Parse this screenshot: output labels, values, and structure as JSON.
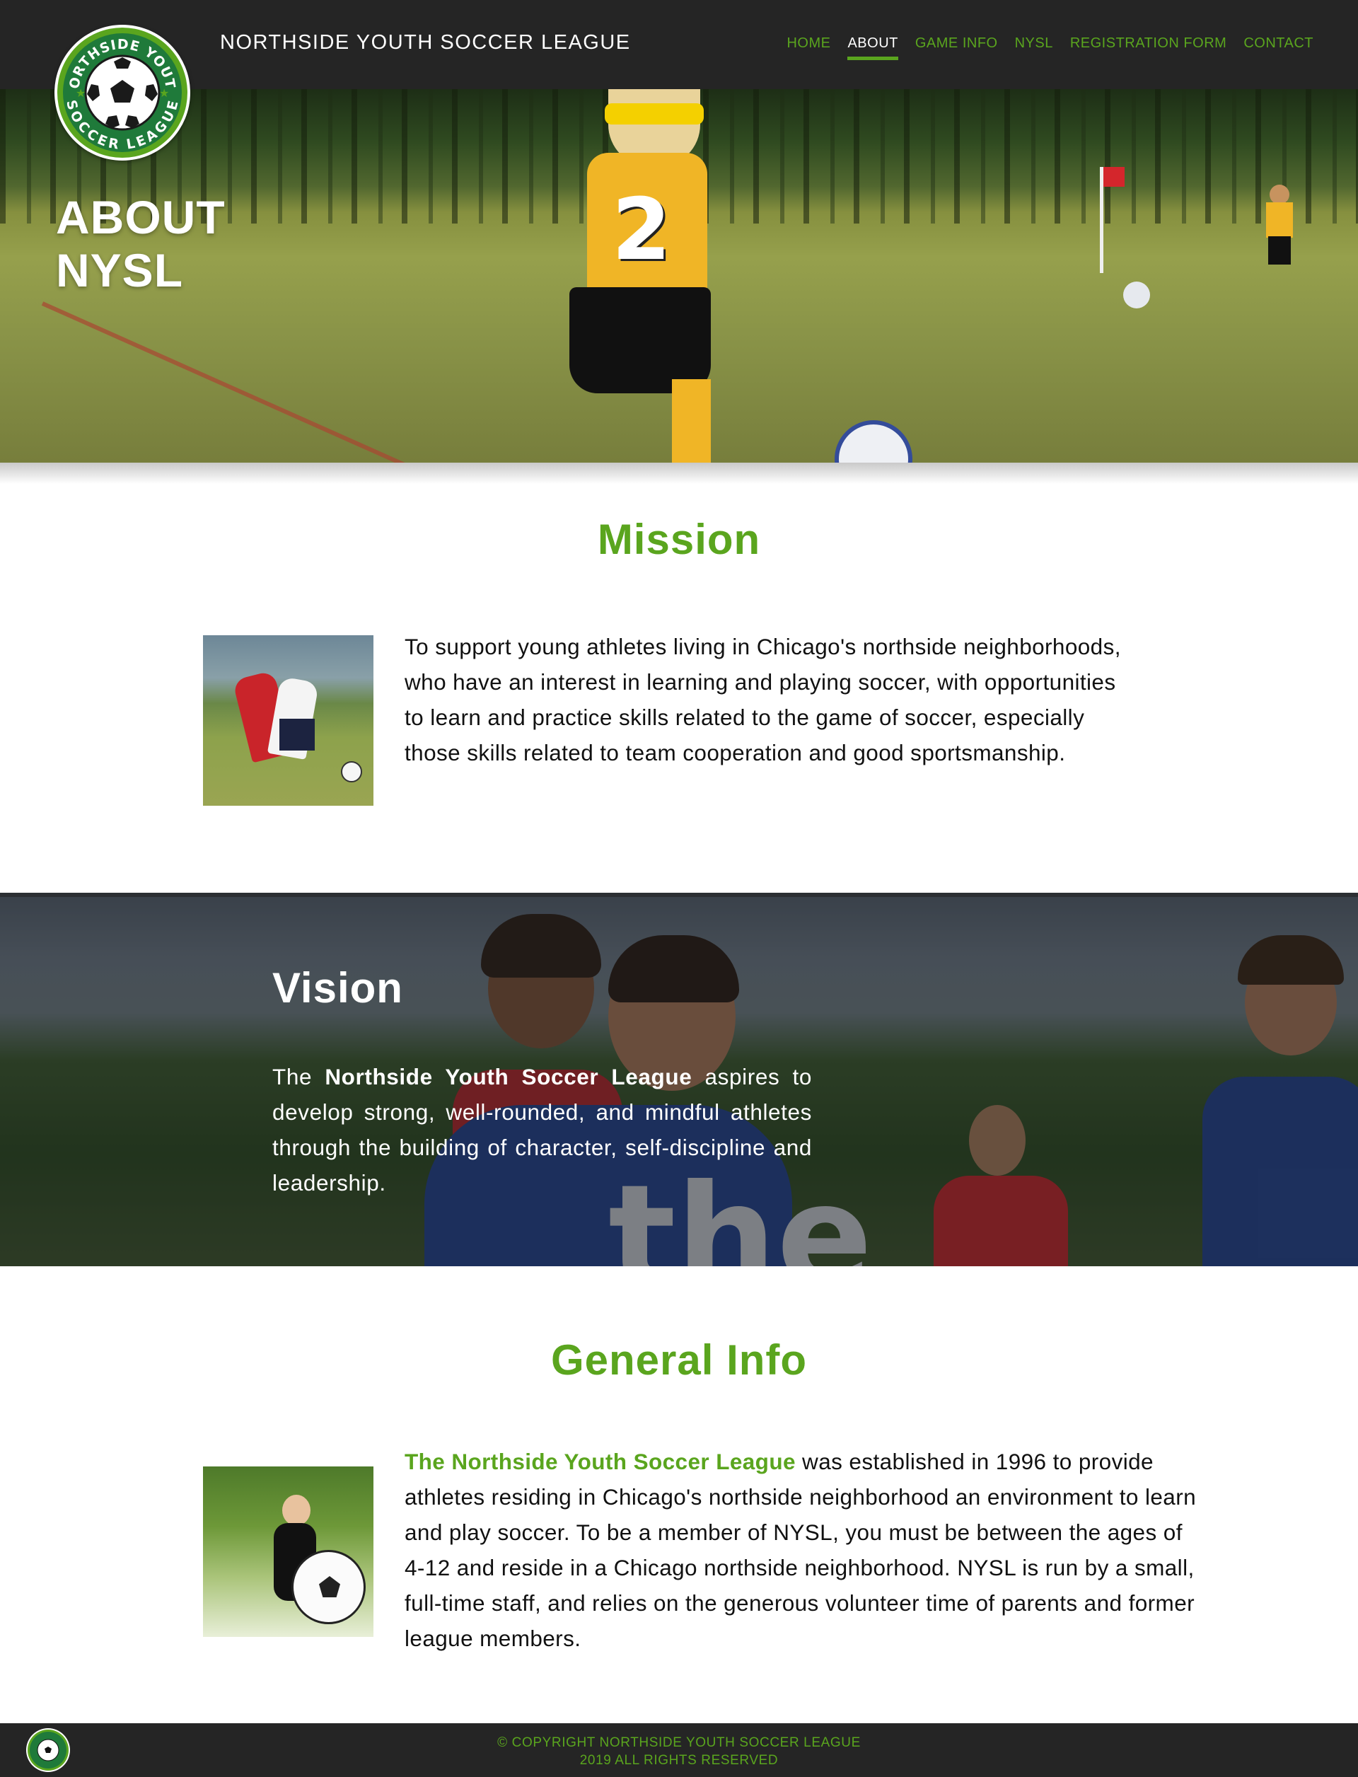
{
  "header": {
    "site_title": "NORTHSIDE YOUTH SOCCER LEAGUE",
    "logo_text_top": "NORTHSIDE YOUTH",
    "logo_text_bottom": "SOCCER LEAGUE",
    "nav": [
      {
        "label": "HOME",
        "active": false
      },
      {
        "label": "ABOUT",
        "active": true
      },
      {
        "label": "GAME INFO",
        "active": false
      },
      {
        "label": "NYSL",
        "active": false
      },
      {
        "label": "REGISTRATION FORM",
        "active": false
      },
      {
        "label": "CONTACT",
        "active": false
      }
    ]
  },
  "hero": {
    "title_line1": "ABOUT",
    "title_line2": "NYSL",
    "jersey_number": "2"
  },
  "mission": {
    "title": "Mission",
    "text": "To support young athletes living in Chicago's northside neighborhoods, who have an interest in learning and playing soccer, with opportunities to learn and practice skills related to the game of soccer, especially those skills related to team cooperation and good sportsmanship."
  },
  "vision": {
    "title": "Vision",
    "text_prefix": "The ",
    "text_bold": "Northside Youth Soccer League",
    "text_suffix": " aspires to develop strong, well-rounded, and mindful athletes through the building of character, self-discipline and leadership.",
    "shirt_logo": "the Y"
  },
  "general_info": {
    "title": "General Info",
    "text_bold": "The Northside Youth Soccer League",
    "text_rest": " was established in 1996 to provide athletes residing in Chicago's northside neighborhood an environment to learn and play soccer. To be a member of NYSL, you must be between the ages of 4-12 and reside in a Chicago northside neighborhood. NYSL is run by a small, full-time staff, and relies on the generous volunteer time of parents and former league members."
  },
  "footer": {
    "line1": "© COPYRIGHT NORTHSIDE YOUTH SOCCER LEAGUE",
    "line2": "2019 ALL RIGHTS RESERVED"
  },
  "colors": {
    "accent": "#5aa51e",
    "header_bg": "#252525",
    "logo_ring": "#1f7a3a"
  },
  "icons": {
    "logo": "soccer-ball-icon"
  }
}
